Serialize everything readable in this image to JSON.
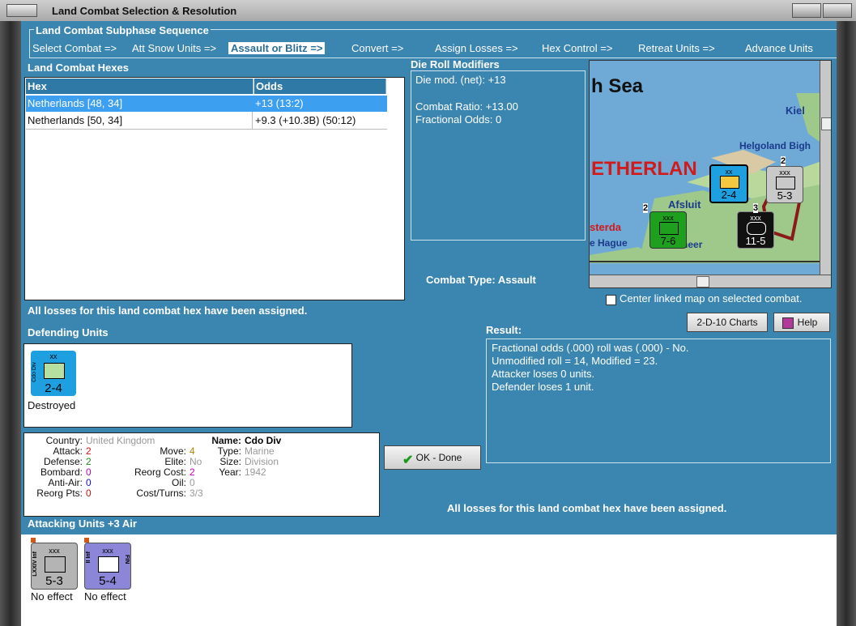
{
  "window": {
    "title": "Land Combat Selection & Resolution"
  },
  "sequence": {
    "title": "Land Combat Subphase Sequence",
    "steps": [
      {
        "label": "Select Combat =>",
        "active": false
      },
      {
        "label": "Att Snow Units =>",
        "active": false
      },
      {
        "label": "Assault or Blitz =>",
        "active": true
      },
      {
        "label": "Convert =>",
        "active": false
      },
      {
        "label": "Assign Losses =>",
        "active": false
      },
      {
        "label": "Hex Control =>",
        "active": false
      },
      {
        "label": "Retreat Units =>",
        "active": false
      },
      {
        "label": "Advance Units",
        "active": false
      }
    ]
  },
  "hexes": {
    "title": "Land Combat Hexes",
    "columns": [
      "Hex",
      "Odds"
    ],
    "rows": [
      {
        "hex": "Netherlands [48, 34]",
        "odds": "+13 (13:2)",
        "selected": true
      },
      {
        "hex": "Netherlands [50, 34]",
        "odds": "+9.3 (+10.3B) (50:12)",
        "selected": false
      }
    ]
  },
  "die_roll": {
    "title": "Die Roll Modifiers",
    "net": "Die mod. (net): +13",
    "ratio": "Combat Ratio: +13.00",
    "fractional": "Fractional Odds: 0"
  },
  "combat_type": "Combat Type:  Assault",
  "map": {
    "labels": [
      "h Sea",
      "Kiel",
      "Helgoland Bigh",
      "ETHERLAN",
      "Afsluit",
      "sterda",
      "e Hague",
      "selmeer"
    ],
    "counters": [
      {
        "value": "2-4",
        "cls": "xx"
      },
      {
        "value": "5-3",
        "cls": "xxx"
      },
      {
        "value": "7-6",
        "cls": "xxx"
      },
      {
        "value": "11-5",
        "cls": "xxx"
      }
    ],
    "stack_numbers": [
      "2",
      "2",
      "3"
    ]
  },
  "center_map": {
    "label": "Center linked map on selected combat.",
    "checked": false
  },
  "buttons": {
    "charts": "2-D-10 Charts",
    "help": "Help",
    "ok": "OK - Done"
  },
  "losses_msg": "All losses for this land combat hex have been assigned.",
  "defending": {
    "title": "Defending Units",
    "units": [
      {
        "cls": "xx",
        "side": "Cdo Div",
        "value": "2-4",
        "status": "Destroyed",
        "color": "#1ea0e0"
      }
    ]
  },
  "result": {
    "title": "Result:",
    "lines": [
      "Fractional odds (.000) roll was (.000)  - No.",
      "Unmodified roll = 14, Modified = 23.",
      "Attacker loses 0 units.",
      "Defender loses 1 unit."
    ]
  },
  "unit_info": {
    "country_label": "Country:",
    "country": "United Kingdom",
    "attack_label": "Attack:",
    "attack": "2",
    "defense_label": "Defense:",
    "defense": "2",
    "bombard_label": "Bombard:",
    "bombard": "0",
    "antiair_label": "Anti-Air:",
    "antiair": "0",
    "reorgpts_label": "Reorg Pts:",
    "reorgpts": "0",
    "move_label": "Move:",
    "move": "4",
    "elite_label": "Elite:",
    "elite": "No",
    "reorgcost_label": "Reorg Cost:",
    "reorgcost": "2",
    "oil_label": "Oil:",
    "oil": "0",
    "costturns_label": "Cost/Turns:",
    "costturns": "3/3",
    "name_label": "Name:",
    "name": "Cdo Div",
    "type_label": "Type:",
    "type": "Marine",
    "size_label": "Size:",
    "size": "Division",
    "year_label": "Year:",
    "year": "1942"
  },
  "attacking": {
    "title": "Attacking Units +3 Air",
    "units": [
      {
        "cls": "xxx",
        "side": "LXXIV Inf",
        "value": "5-3",
        "status": "No effect",
        "color": "#b4b4b4"
      },
      {
        "cls": "xxx",
        "side": "II Inf",
        "side2": "FIN",
        "value": "5-4",
        "status": "No effect",
        "color": "#8b86d8"
      }
    ]
  },
  "colors": {
    "panel": "#3b86b0",
    "selected_row": "#3d9ff0",
    "attack": "#d01010",
    "move": "#b08000",
    "bombard": "#c000c0",
    "antiair": "#1010c0"
  }
}
